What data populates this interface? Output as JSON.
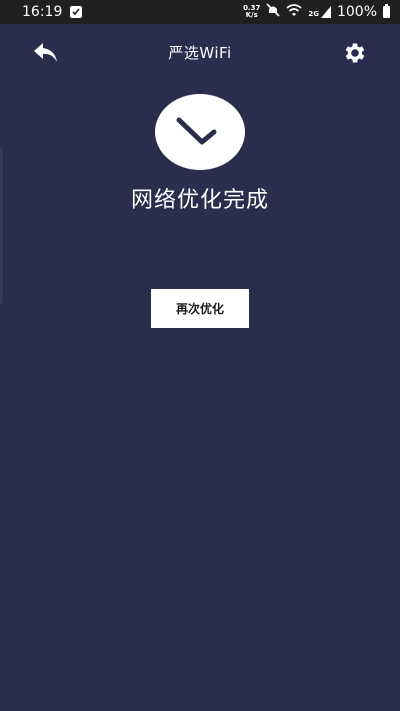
{
  "status_bar": {
    "time": "16:19",
    "net_speed_value": "0.37",
    "net_speed_unit": "K/s",
    "signal_label": "2G",
    "battery": "100%"
  },
  "app_bar": {
    "title": "严选WiFi",
    "back_icon": "back-arrow-icon",
    "settings_icon": "gear-icon"
  },
  "main": {
    "status_icon": "check-icon",
    "result_text": "网络优化完成",
    "reoptimize_label": "再次优化"
  },
  "colors": {
    "background": "#2a2e4c",
    "status_bar": "#202020",
    "foreground": "#ffffff",
    "button_text": "#1a1a1a"
  }
}
